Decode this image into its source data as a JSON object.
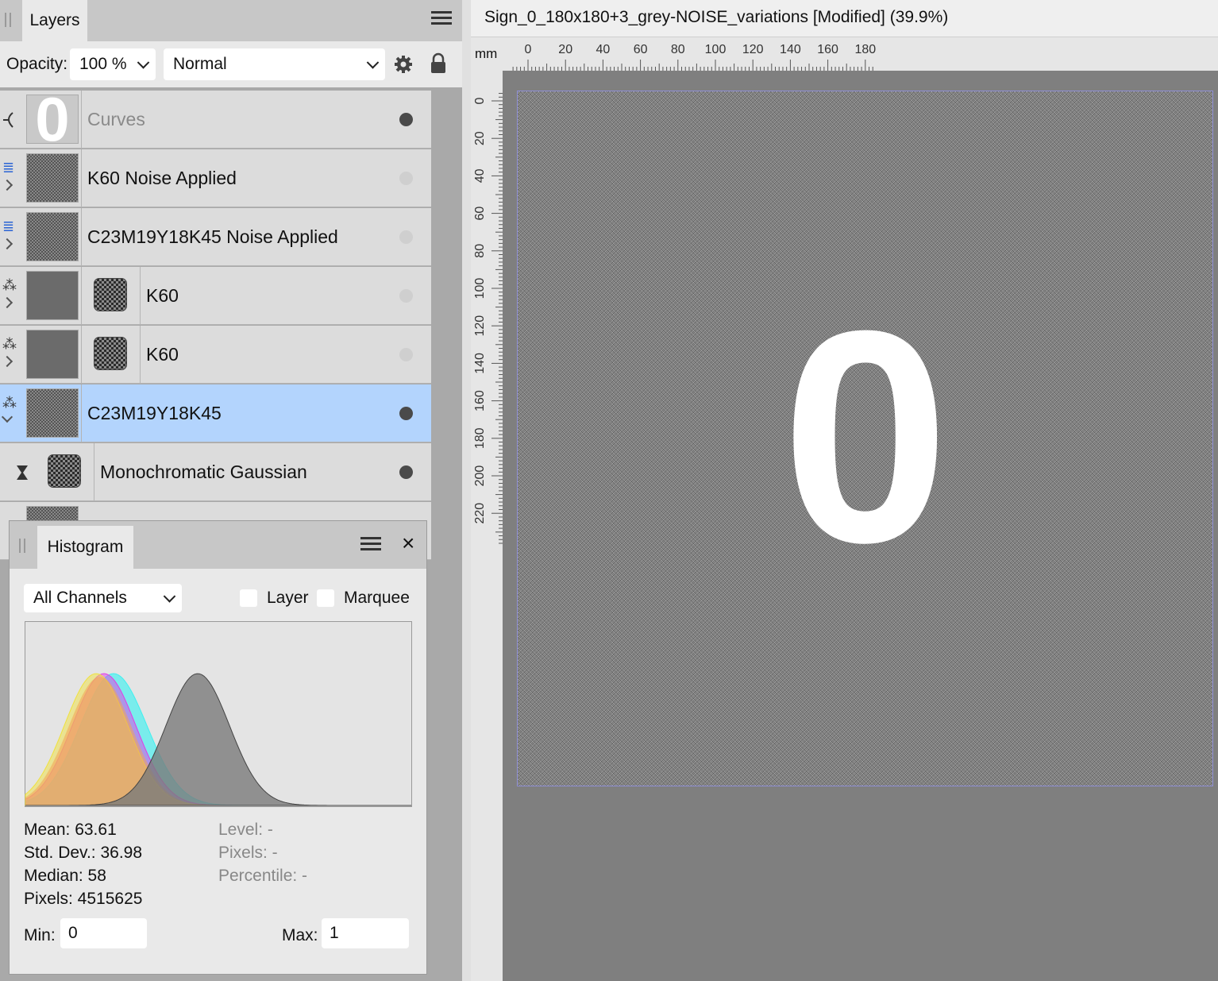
{
  "layers_panel": {
    "tab_label": "Layers",
    "opacity_label": "Opacity:",
    "opacity_value": "100 %",
    "blend_mode": "Normal",
    "layers": [
      {
        "name": "Curves",
        "visible": true,
        "dimmed": true
      },
      {
        "name": "K60 Noise Applied",
        "visible": false
      },
      {
        "name": "C23M19Y18K45 Noise Applied",
        "visible": false
      },
      {
        "name": "K60",
        "visible": false
      },
      {
        "name": "K60",
        "visible": false
      },
      {
        "name": "C23M19Y18K45",
        "visible": true,
        "selected": true
      },
      {
        "name": "Monochromatic Gaussian",
        "visible": true,
        "child": true
      }
    ],
    "curves_thumb_glyph": "0"
  },
  "histogram": {
    "tab_label": "Histogram",
    "close_glyph": "×",
    "channel": "All Channels",
    "layer_label": "Layer",
    "marquee_label": "Marquee",
    "mean": "Mean: 63.61",
    "std_dev": "Std. Dev.: 36.98",
    "median": "Median: 58",
    "pixels": "Pixels: 4515625",
    "level": "Level: -",
    "pixels_sel": "Pixels: -",
    "percentile": "Percentile: -",
    "min_label": "Min:",
    "min_value": "0",
    "max_label": "Max:",
    "max_value": "1",
    "colors": {
      "cyan": "#3ff0f0",
      "magenta": "#e13de5",
      "yellow": "#f0e23d",
      "grey": "#7a7a7a",
      "composite": "#f2a455"
    }
  },
  "document": {
    "title": "Sign_0_180x180+3_grey-NOISE_variations [Modified] (39.9%)",
    "ruler_unit": "mm",
    "h_ticks": [
      "0",
      "20",
      "40",
      "60",
      "80",
      "100",
      "120",
      "140",
      "160",
      "180"
    ],
    "v_ticks": [
      "0",
      "20",
      "40",
      "60",
      "80",
      "100",
      "120",
      "140",
      "160",
      "180",
      "200",
      "220"
    ],
    "content_glyph": "0"
  }
}
